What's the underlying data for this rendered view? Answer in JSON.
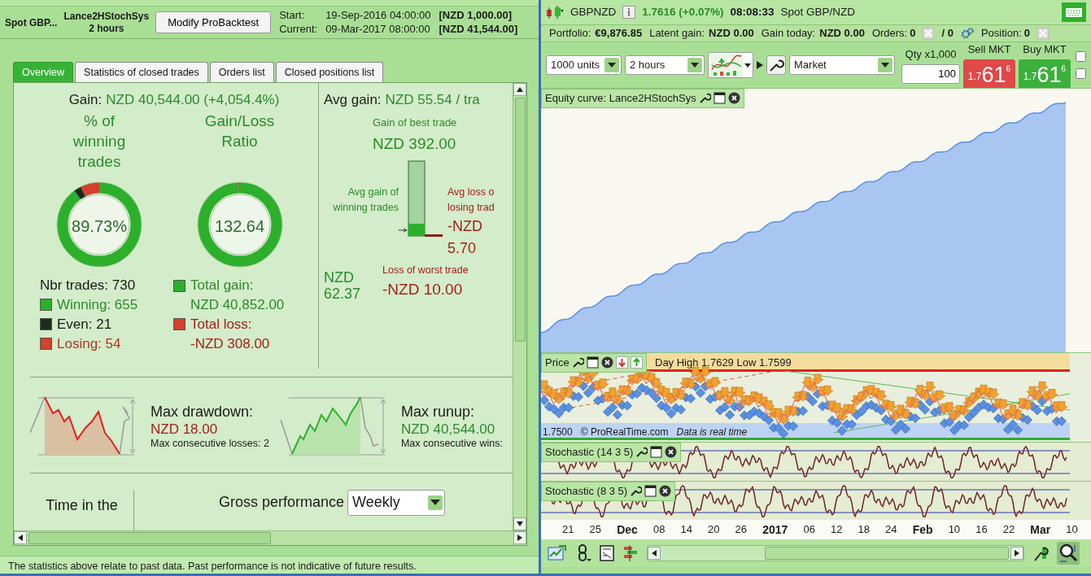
{
  "report": {
    "instrument": "Spot GBP...",
    "system": "Lance2HStochSys",
    "timeframe": "2 hours",
    "modify_button": "Modify ProBacktest",
    "start_label": "Start:",
    "start_date": "19-Sep-2016 04:00:00",
    "start_value": "[NZD 1,000.00]",
    "current_label": "Current:",
    "current_date": "09-Mar-2017 08:00:00",
    "current_value": "[NZD 41,544.00]",
    "tabs": [
      {
        "label": "Overview",
        "selected": true
      },
      {
        "label": "Statistics of closed trades",
        "selected": false
      },
      {
        "label": "Orders list",
        "selected": false
      },
      {
        "label": "Closed positions list",
        "selected": false
      }
    ],
    "gain_label": "Gain:",
    "gain_value": "NZD 40,544.00 (+4,054.4%)",
    "winning_title": "% of winning trades",
    "winning_ring": {
      "center": "89.73%",
      "segments": [
        {
          "color": "#2cb02c",
          "level": 0.8973
        },
        {
          "color": "#1c2c1c",
          "level": 0.0288
        },
        {
          "color": "#d4402e",
          "level": 0.0739
        }
      ]
    },
    "ratio_title": "Gain/Loss Ratio",
    "ratio_ring": {
      "center": "132.64",
      "segments": [
        {
          "color": "#2cb02c",
          "level": 0.9925
        },
        {
          "color": "#d4402e",
          "level": 0.0075
        }
      ]
    },
    "nbr_trades": "Nbr trades: 730",
    "trade_legend": [
      {
        "label": "Winning: 655",
        "color": "#2cb02c"
      },
      {
        "label": "Even: 21",
        "color": "#1c2c1c"
      },
      {
        "label": "Losing: 54",
        "color": "#d4402e"
      }
    ],
    "gain_legend": [
      {
        "label": "Total gain:",
        "value": "NZD 40,852.00",
        "color": "#2cb02c"
      },
      {
        "label": "Total loss:",
        "value": "-NZD 308.00",
        "color": "#d4402e"
      }
    ],
    "avg_gain_label": "Avg gain:",
    "avg_gain_value": "NZD 55.54 / tra",
    "best_trade_label": "Gain of best trade",
    "best_trade_value": "NZD 392.00",
    "avg_win_label": "Avg gain of winning trades",
    "avg_win_value": "NZD 62.37",
    "avg_loss_label": "Avg loss o losing trad",
    "avg_loss_value": "-NZD 5.70",
    "worst_label": "Loss of worst trade",
    "worst_value": "-NZD 10.00",
    "drawdown": {
      "title": "Max drawdown:",
      "value": "NZD 18.00",
      "note": "Max consecutive losses: 2"
    },
    "runup": {
      "title": "Max runup:",
      "value": "NZD 40,544.00",
      "note": "Max consecutive wins:"
    },
    "time_in_market": "Time in the",
    "gross_label": "Gross performance",
    "gross_select": "Weekly",
    "disclaimer": "The statistics above relate to past data. Past performance is not indicative of future results."
  },
  "chart_window": {
    "symbol": "GBPNZD",
    "quote": "1.7616 (+0.07%)",
    "time": "08:08:33",
    "market": "Spot GBP/NZD",
    "portfolio": [
      {
        "label": "Portfolio:",
        "value": "€9,876.85"
      },
      {
        "label": "Latent gain:",
        "value": "NZD 0.00"
      },
      {
        "label": "Gain today:",
        "value": "NZD 0.00"
      }
    ],
    "orders_label": "Orders:",
    "orders_value": "0",
    "orders_pending": "/ 0",
    "position_label": "Position:",
    "position_value": "0",
    "units_select": "1000 units",
    "period_select": "2 hours",
    "order_type_select": "Market",
    "qty_label": "Qty x1,000",
    "qty_value": "100",
    "sell": {
      "label": "Sell MKT",
      "prefix": "1.7",
      "main": "61",
      "sup": "6"
    },
    "buy": {
      "label": "Buy MKT",
      "prefix": "1.7",
      "main": "61",
      "sup": "6"
    },
    "side_checkboxes": [
      {
        "checked": false
      },
      {
        "checked": false
      }
    ],
    "equity_title": "Equity curve: Lance2HStochSys",
    "price_title": "Price",
    "price_info": "Day High 1.7629 Low 1.7599",
    "price_level": "1.7500",
    "copyright": "© ProRealTime.com",
    "data_note": "Data is real time",
    "indicators": [
      {
        "title": "Stochastic (14 3 5)"
      },
      {
        "title": "Stochastic (8 3 5)"
      }
    ],
    "x_labels": [
      {
        "text": "21",
        "bold": false
      },
      {
        "text": "25",
        "bold": false
      },
      {
        "text": "Dec",
        "bold": true
      },
      {
        "text": "08",
        "bold": false
      },
      {
        "text": "14",
        "bold": false
      },
      {
        "text": "20",
        "bold": false
      },
      {
        "text": "26",
        "bold": false
      },
      {
        "text": "2017",
        "bold": true
      },
      {
        "text": "06",
        "bold": false
      },
      {
        "text": "12",
        "bold": false
      },
      {
        "text": "18",
        "bold": false
      },
      {
        "text": "24",
        "bold": false
      },
      {
        "text": "Feb",
        "bold": true
      },
      {
        "text": "10",
        "bold": false
      },
      {
        "text": "16",
        "bold": false
      },
      {
        "text": "22",
        "bold": false
      },
      {
        "text": "Mar",
        "bold": true
      },
      {
        "text": "10",
        "bold": false
      }
    ]
  }
}
